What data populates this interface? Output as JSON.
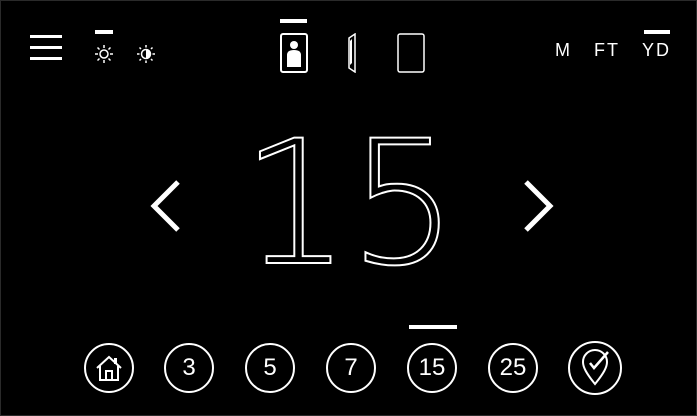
{
  "top_bar": {
    "menu_icon": "hamburger-menu-icon",
    "brightness": {
      "options": [
        "brightness-high-icon",
        "contrast-icon"
      ],
      "selected": "brightness-high-icon"
    },
    "target_modes": {
      "options": [
        "silhouette-target-icon",
        "edge-on-target-icon",
        "blank-target-icon"
      ],
      "selected": "silhouette-target-icon"
    },
    "units": {
      "options": [
        "M",
        "FT",
        "YD"
      ],
      "selected": "YD"
    }
  },
  "main": {
    "distance_value": "15",
    "prev_icon": "chevron-left-icon",
    "next_icon": "chevron-right-icon"
  },
  "presets": {
    "home_icon": "home-icon",
    "values": [
      "3",
      "5",
      "7",
      "15",
      "25"
    ],
    "selected": "15",
    "custom_icon": "map-pin-check-icon"
  },
  "colors": {
    "background": "#000000",
    "foreground": "#ffffff"
  }
}
